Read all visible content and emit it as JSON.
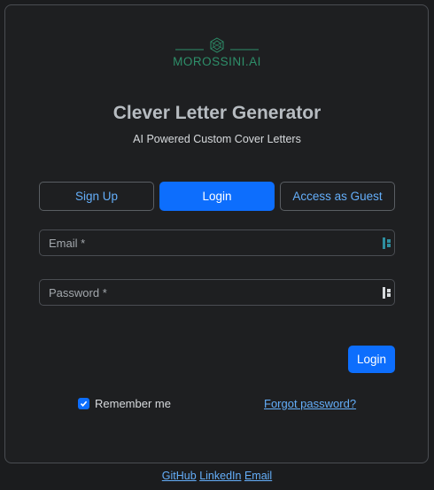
{
  "brand": {
    "logo_text": "MOROSSINI.AI",
    "icon": "geometric-globe-icon"
  },
  "header": {
    "title": "Clever Letter Generator",
    "subtitle": "AI Powered Custom Cover Letters"
  },
  "auth_tabs": {
    "signup_label": "Sign Up",
    "login_label": "Login",
    "guest_label": "Access as Guest",
    "active": "Login"
  },
  "form": {
    "email_placeholder": "Email *",
    "password_placeholder": "Password *",
    "submit_label": "Login",
    "remember_label": "Remember me",
    "remember_checked": true,
    "forgot_label": "Forgot password?"
  },
  "footer": {
    "links": [
      "GitHub",
      "LinkedIn",
      "Email"
    ]
  },
  "colors": {
    "primary": "#0d6efd",
    "link": "#64aef9",
    "logo": "#2e8f6a",
    "background": "#1e1f21"
  }
}
